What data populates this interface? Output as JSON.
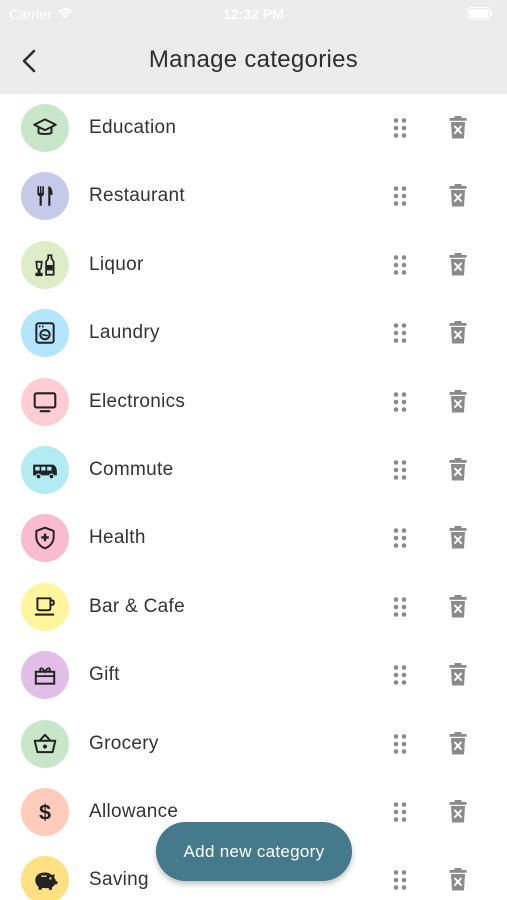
{
  "status_bar": {
    "carrier": "Carrier",
    "time": "12:32 PM"
  },
  "header": {
    "title": "Manage categories",
    "back_icon": "chevron-left-icon"
  },
  "categories": [
    {
      "label": "Education",
      "icon": "graduation-cap-icon",
      "bg": "#c8e6c9"
    },
    {
      "label": "Restaurant",
      "icon": "fork-knife-icon",
      "bg": "#c5cae9"
    },
    {
      "label": "Liquor",
      "icon": "bottles-icon",
      "bg": "#dcedc8"
    },
    {
      "label": "Laundry",
      "icon": "washing-machine-icon",
      "bg": "#b3e5fc"
    },
    {
      "label": "Electronics",
      "icon": "monitor-icon",
      "bg": "#ffcdd2"
    },
    {
      "label": "Commute",
      "icon": "bus-icon",
      "bg": "#b2ebf2"
    },
    {
      "label": "Health",
      "icon": "shield-plus-icon",
      "bg": "#f8bbd0"
    },
    {
      "label": "Bar & Cafe",
      "icon": "coffee-cup-icon",
      "bg": "#fff59d"
    },
    {
      "label": "Gift",
      "icon": "gift-icon",
      "bg": "#e1bee7"
    },
    {
      "label": "Grocery",
      "icon": "basket-icon",
      "bg": "#c8e6c9"
    },
    {
      "label": "Allowance",
      "icon": "dollar-icon",
      "bg": "#ffccbc"
    },
    {
      "label": "Saving",
      "icon": "piggy-bank-icon",
      "bg": "#ffe082"
    }
  ],
  "row_actions": {
    "drag_icon": "drag-handle-icon",
    "delete_icon": "trash-icon"
  },
  "fab": {
    "label": "Add new category"
  },
  "colors": {
    "header_bg": "#ececec",
    "fab_bg": "#447a8c",
    "icon_gray": "#8a8a8a"
  }
}
